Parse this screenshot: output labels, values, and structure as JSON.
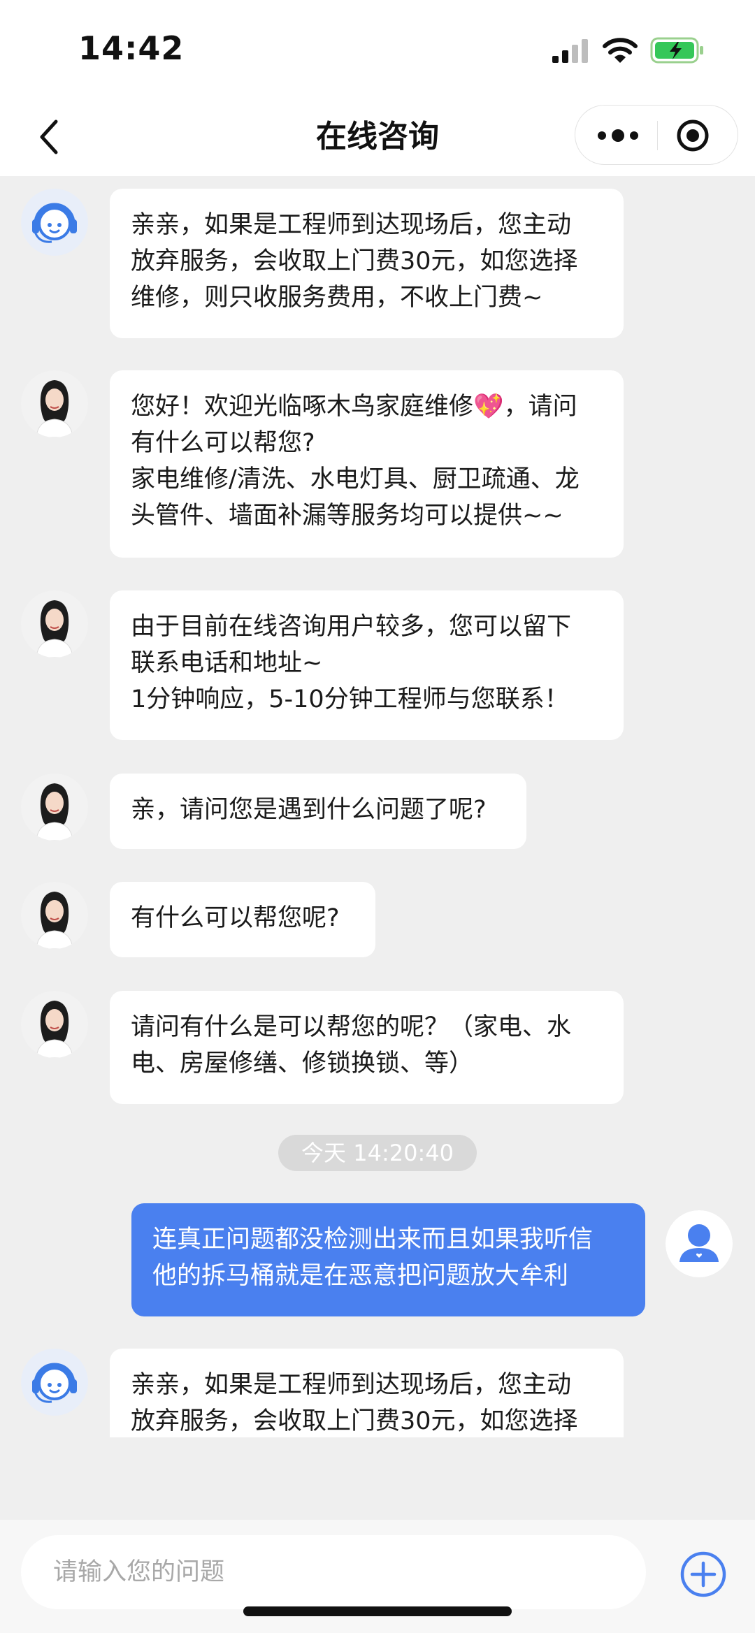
{
  "status": {
    "time": "14:42"
  },
  "nav": {
    "title": "在线咨询"
  },
  "messages": [
    {
      "from": "agent",
      "avatar": "headset-agent",
      "text": "亲亲，如果是工程师到达现场后，您主动\n放弃服务，会收取上门费30元，如您选择\n维修，则只收服务费用，不收上门费~"
    },
    {
      "from": "agent",
      "avatar": "woman",
      "text": "您好！欢迎光临啄木鸟家庭维修💖，请问\n有什么可以帮您?\n家电维修/清洗、水电灯具、厨卫疏通、龙\n头管件、墙面补漏等服务均可以提供~~"
    },
    {
      "from": "agent",
      "avatar": "woman",
      "text": "由于目前在线咨询用户较多，您可以留下\n联系电话和地址~\n1分钟响应，5-10分钟工程师与您联系！"
    },
    {
      "from": "agent",
      "avatar": "woman",
      "text": "亲，请问您是遇到什么问题了呢?"
    },
    {
      "from": "agent",
      "avatar": "woman",
      "text": "有什么可以帮您呢?"
    },
    {
      "from": "agent",
      "avatar": "woman",
      "text": "请问有什么是可以帮您的呢？（家电、水\n电、房屋修缮、修锁换锁、等）"
    },
    {
      "from": "user",
      "avatar": "user",
      "text": "连真正问题都没检测出来而且如果我听信\n他的拆马桶就是在恶意把问题放大牟利"
    },
    {
      "from": "agent",
      "avatar": "headset-agent",
      "text": "亲亲，如果是工程师到达现场后，您主动\n放弃服务，会收取上门费30元，如您选择\n维修，则只收服务费用，不收上门费~"
    }
  ],
  "timestamp": "今天 14:20:40",
  "input": {
    "placeholder": "请输入您的问题"
  },
  "colors": {
    "accent": "#4a80ef",
    "background": "#efefef",
    "bubble": "#ffffff"
  },
  "icons": [
    "back-icon",
    "more-icon",
    "close-target-icon",
    "headset-agent-icon",
    "user-avatar-icon",
    "add-icon"
  ]
}
